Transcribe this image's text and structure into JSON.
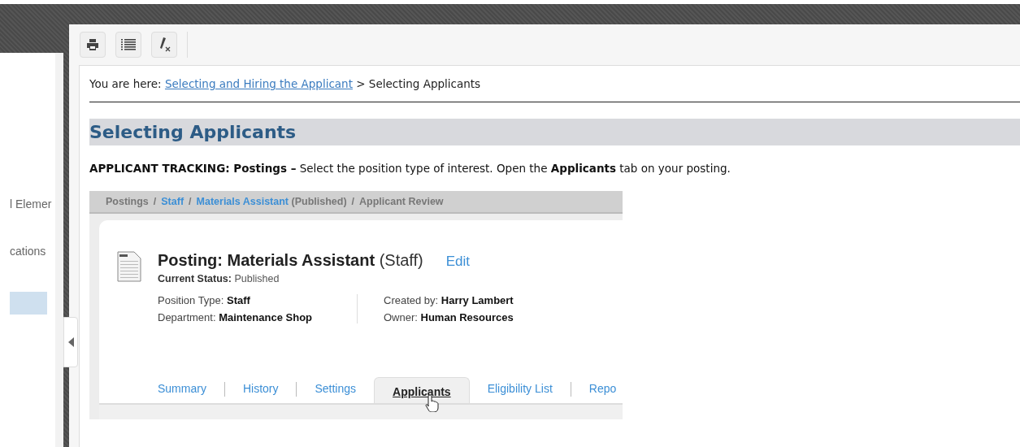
{
  "sidebar": {
    "items": [
      {
        "label": "l Elemer",
        "selected": false
      },
      {
        "label": "cations",
        "selected": false
      },
      {
        "selected": true
      }
    ]
  },
  "toolbar": {
    "buttons": [
      {
        "kind": "print"
      },
      {
        "kind": "list"
      },
      {
        "kind": "clear-format"
      }
    ]
  },
  "breadcrumb": {
    "prefix": "You are here:",
    "link": "Selecting and Hiring the Applicant",
    "separator": ">",
    "current": "Selecting Applicants"
  },
  "heading": "Selecting Applicants",
  "instruction": "**APPLICANT TRACKING: Postings –** Select the position type of interest. Open the **Applicants** tab on your posting.",
  "screenshot": {
    "breadcrumb": [
      {
        "label": "Postings",
        "link": false
      },
      {
        "separator": "/",
        "label": "Staff",
        "link": true
      },
      {
        "separator": "/",
        "label": "Materials Assistant",
        "link": true,
        "note": "(Published)"
      },
      {
        "separator": "/",
        "label": "Applicant Review",
        "link": false
      }
    ],
    "title": "Posting: Materials Assistant",
    "title_note": "(Staff)",
    "edit": "Edit",
    "status_label": "Current Status:",
    "status": "Published",
    "fields": [
      {
        "label": "Position Type:",
        "value": "Staff"
      },
      {
        "label": "Department:",
        "value": "Maintenance Shop"
      },
      {
        "label": "Created by:",
        "value": "Harry Lambert"
      },
      {
        "label": "Owner:",
        "value": "Human Resources"
      }
    ],
    "tabs": [
      {
        "label": "Summary",
        "selected": false
      },
      {
        "label": "History",
        "selected": false
      },
      {
        "label": "Settings",
        "selected": false
      },
      {
        "label": "Applicants",
        "selected": true
      },
      {
        "label": "Eligibility List",
        "selected": false
      },
      {
        "label": "Repo",
        "selected": false
      }
    ]
  }
}
